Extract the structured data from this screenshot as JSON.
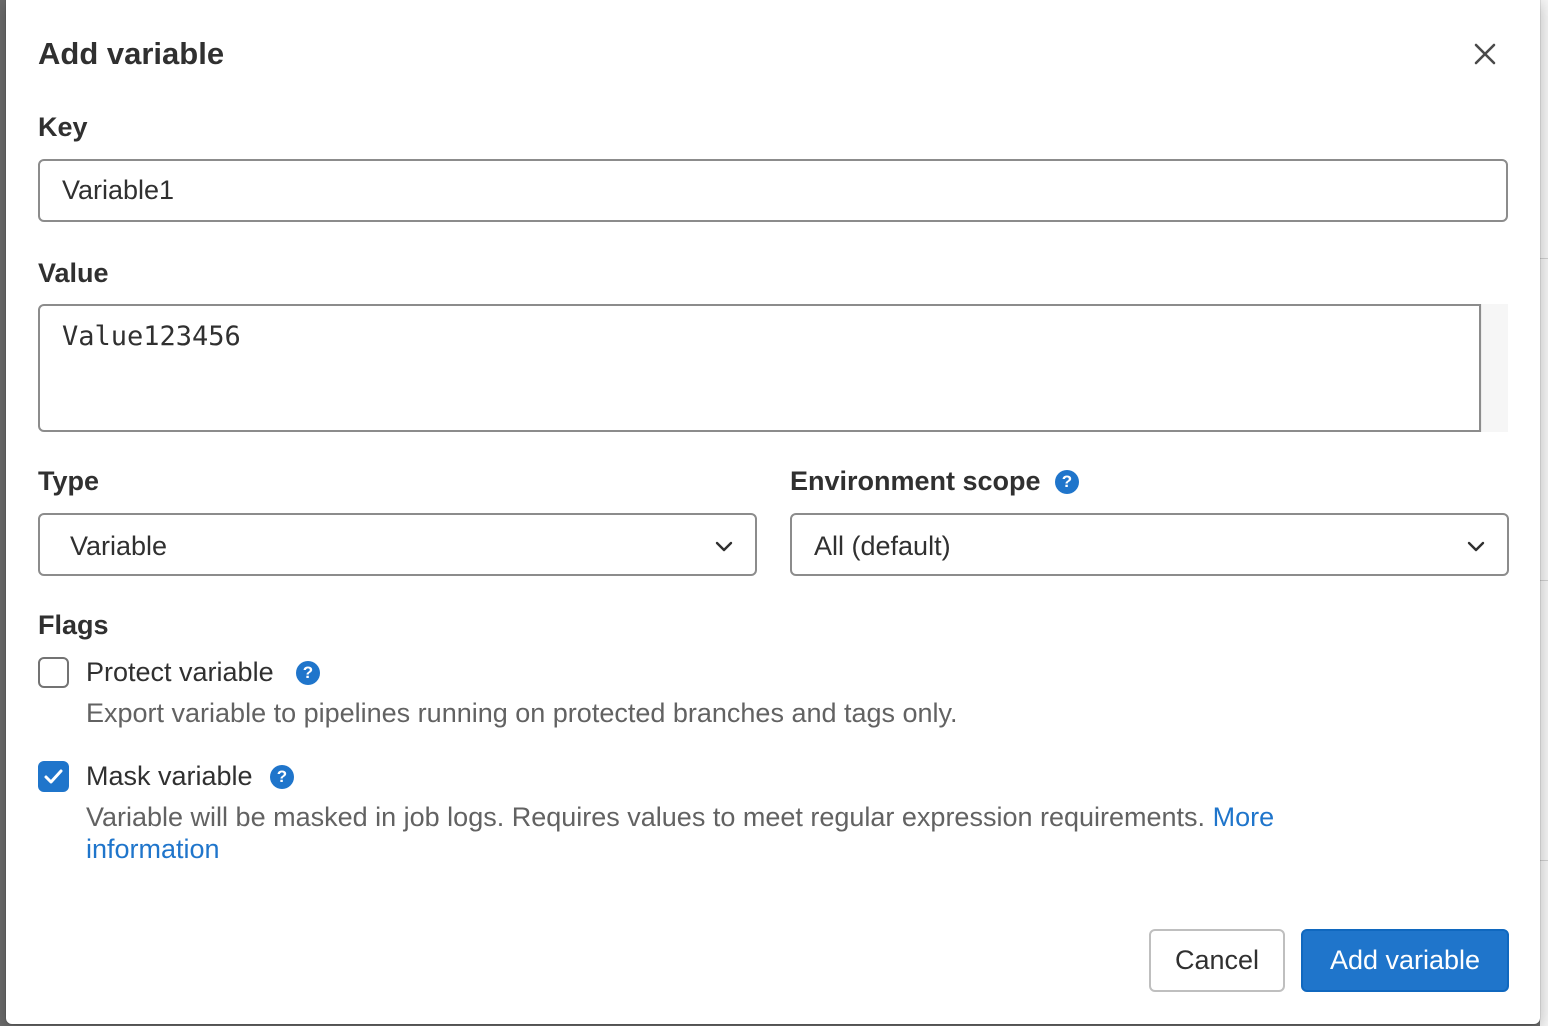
{
  "modal": {
    "title": "Add variable",
    "close_icon": "close-icon"
  },
  "key": {
    "label": "Key",
    "value": "Variable1"
  },
  "value_field": {
    "label": "Value",
    "value": "Value123456"
  },
  "type": {
    "label": "Type",
    "selected": "Variable",
    "icon": "chevron-down-icon"
  },
  "environment_scope": {
    "label": "Environment scope",
    "help_glyph": "?",
    "selected": "All (default)",
    "icon": "chevron-down-icon"
  },
  "flags": {
    "label": "Flags",
    "protect": {
      "label": "Protect variable",
      "checked": false,
      "help_glyph": "?",
      "description": "Export variable to pipelines running on protected branches and tags only."
    },
    "mask": {
      "label": "Mask variable",
      "checked": true,
      "help_glyph": "?",
      "description": "Variable will be masked in job logs. Requires values to meet regular expression requirements.",
      "link_text": "More information"
    }
  },
  "actions": {
    "cancel_label": "Cancel",
    "submit_label": "Add variable"
  },
  "colors": {
    "primary": "#1f75cb",
    "text": "#303030",
    "muted_text": "#626262",
    "border": "#8c8c8c"
  }
}
